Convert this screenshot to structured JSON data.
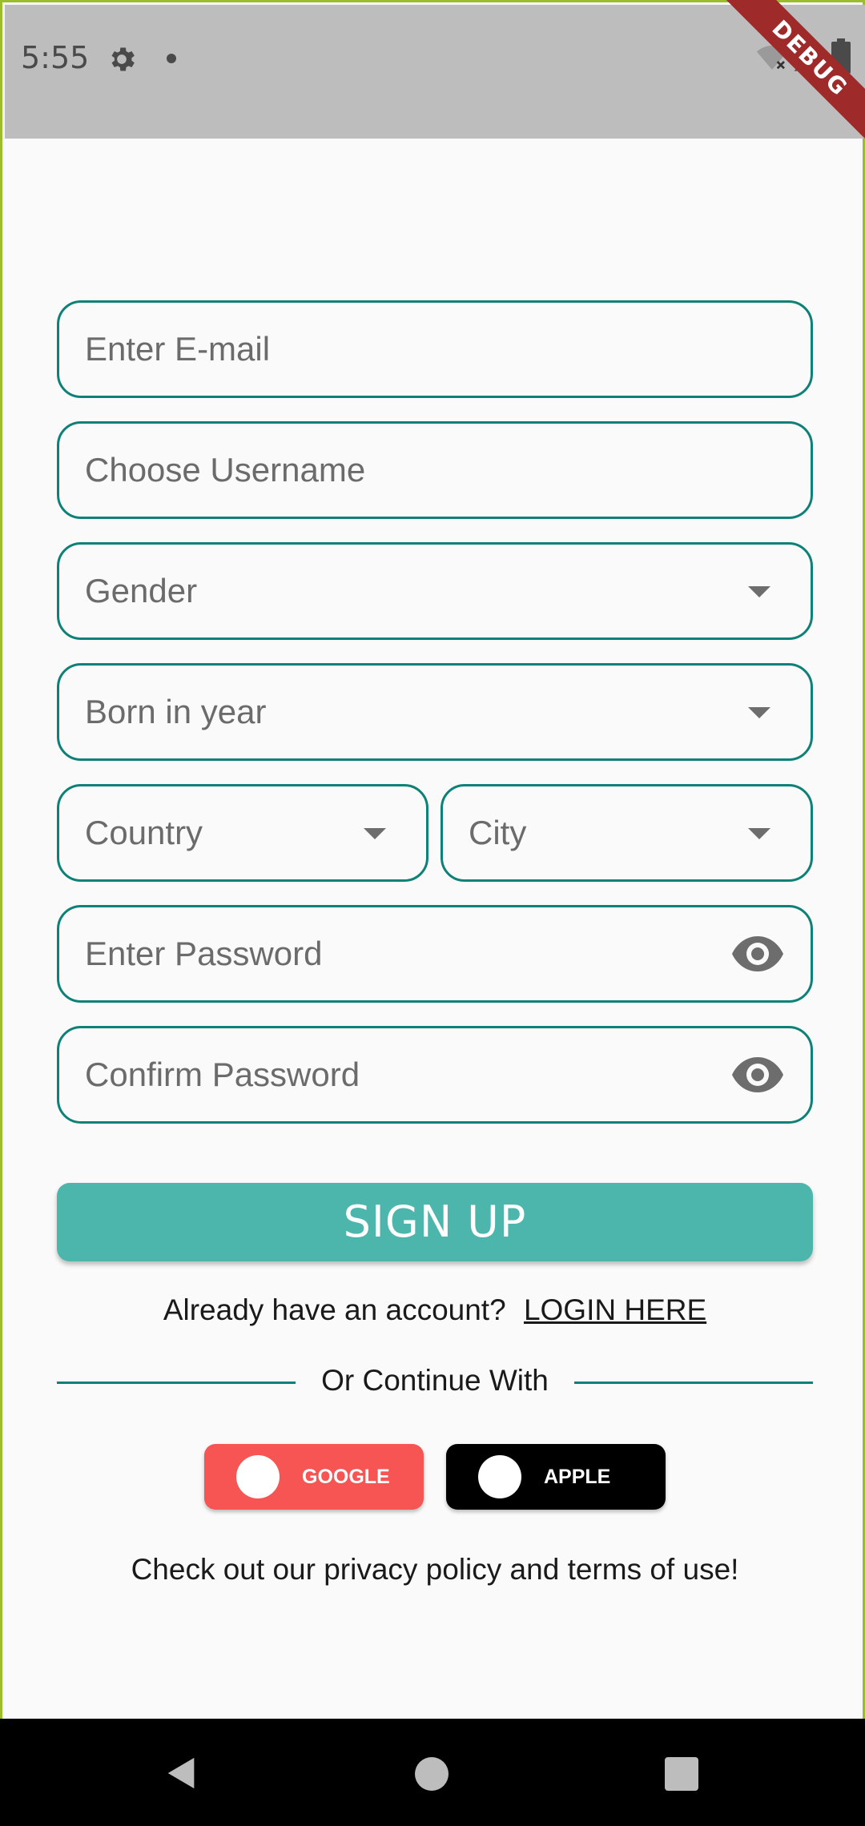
{
  "status_bar": {
    "time": "5:55",
    "icons": [
      "gear-icon",
      "notification-dot",
      "wifi-off-icon",
      "signal-icon",
      "battery-icon"
    ],
    "debug_banner": "DEBUG"
  },
  "form": {
    "email_placeholder": "Enter E-mail",
    "username_placeholder": "Choose Username",
    "gender_placeholder": "Gender",
    "birth_year_placeholder": "Born in year",
    "country_placeholder": "Country",
    "city_placeholder": "City",
    "password_placeholder": "Enter Password",
    "confirm_password_placeholder": "Confirm Password"
  },
  "signup_button": "SIGN UP",
  "login_prompt": {
    "text": "Already have an account?",
    "link": "LOGIN HERE"
  },
  "divider_text": "Or Continue With",
  "social": {
    "google": "GOOGLE",
    "apple": "APPLE"
  },
  "privacy_text": "Check out our privacy policy and terms of use!",
  "colors": {
    "accent": "#0d8177",
    "button": "#4db6ac",
    "google": "#f75454",
    "apple": "#000000",
    "statusbar": "#bdbdbd"
  }
}
